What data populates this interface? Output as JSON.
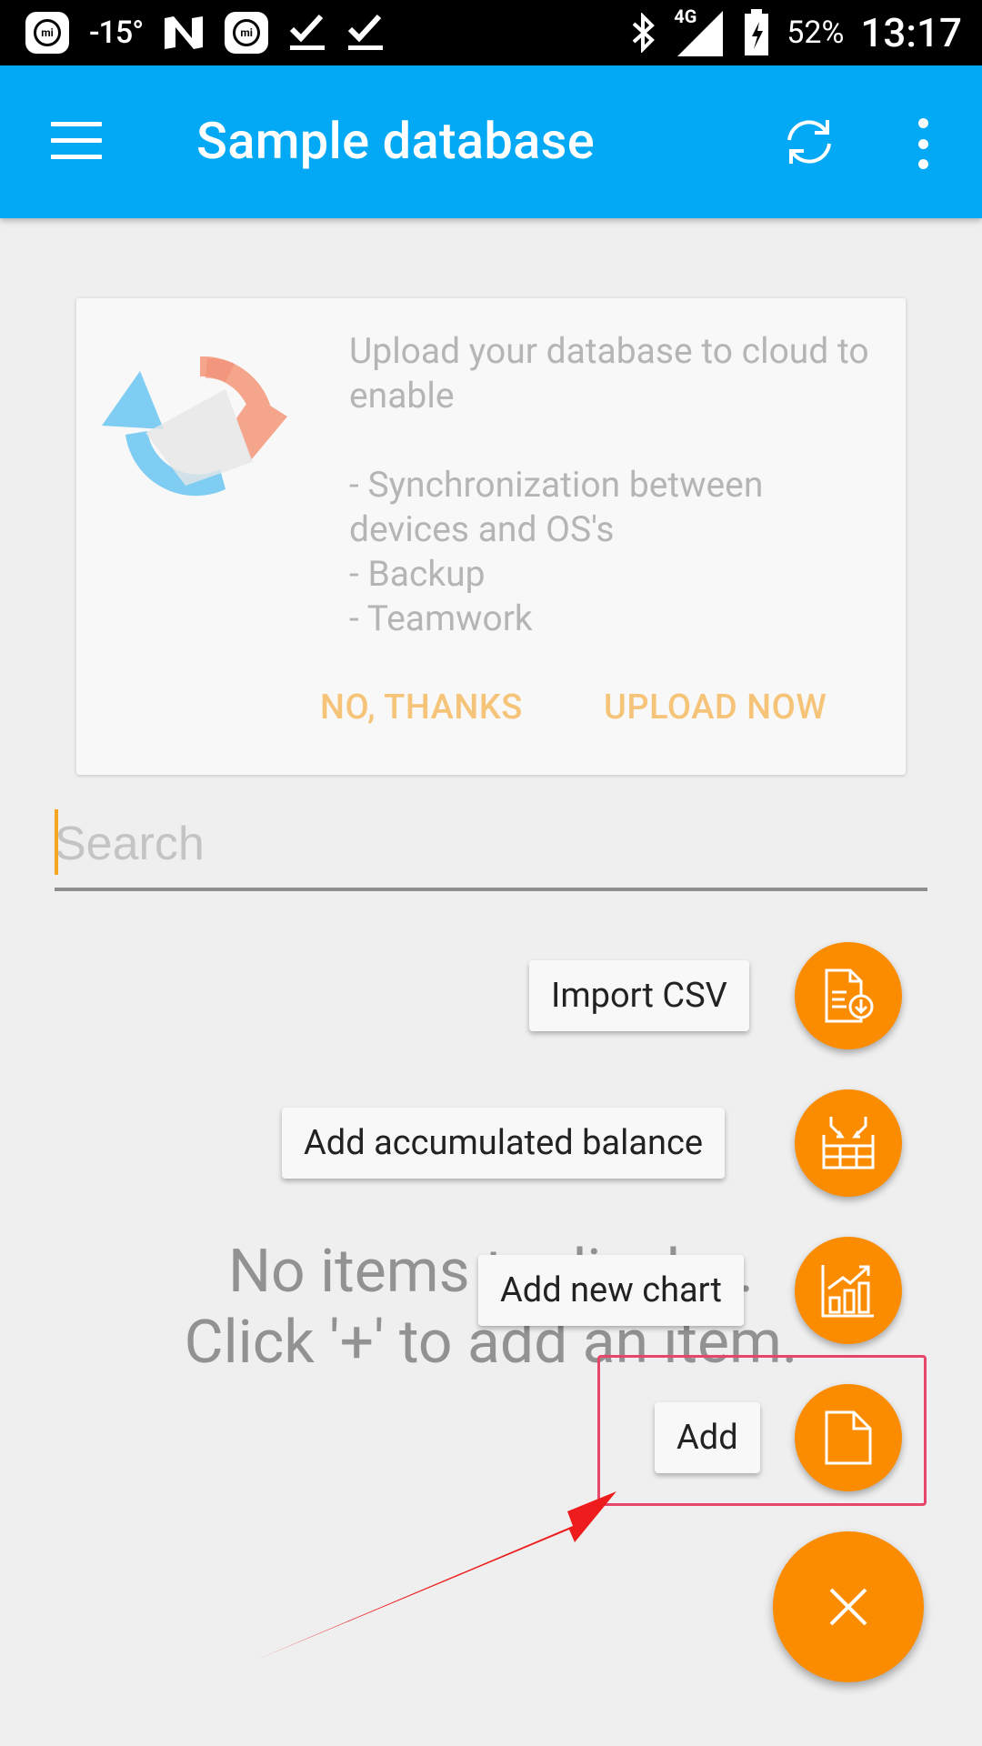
{
  "status_bar": {
    "temperature": "-15°",
    "battery_percent": "52%",
    "network": "4G",
    "time": "13:17",
    "icons": [
      "mi-icon",
      "n-icon",
      "mi-icon",
      "check-icon",
      "check-icon",
      "bluetooth-icon",
      "signal-icon",
      "battery-icon"
    ]
  },
  "app_bar": {
    "title": "Sample database",
    "menu_icon": "hamburger-menu-icon",
    "sync_icon": "sync-icon",
    "overflow_icon": "more-vert-icon",
    "color": "#03a9f4"
  },
  "cloud_card": {
    "line1": "Upload your database to cloud to enable",
    "bullet1": "- Synchronization between devices and OS's",
    "bullet2": "- Backup",
    "bullet3": "- Teamwork",
    "no_thanks": "NO, THANKS",
    "upload_now": "UPLOAD NOW",
    "accent": "#f6c478"
  },
  "search": {
    "placeholder": "Search",
    "value": ""
  },
  "empty_state": {
    "line1": "No items to display.",
    "line2": "Click '+' to add an item."
  },
  "fab_menu": {
    "accent": "#fb8c00",
    "items": [
      {
        "label": "Import CSV",
        "icon": "import-csv-icon"
      },
      {
        "label": "Add accumulated balance",
        "icon": "accumulated-balance-icon"
      },
      {
        "label": "Add new chart",
        "icon": "chart-icon"
      },
      {
        "label": "Add",
        "icon": "document-icon"
      }
    ],
    "close_icon": "close-icon"
  },
  "annotations": {
    "highlight_color": "#e8456a",
    "arrow_color": "#ee1c1c"
  }
}
